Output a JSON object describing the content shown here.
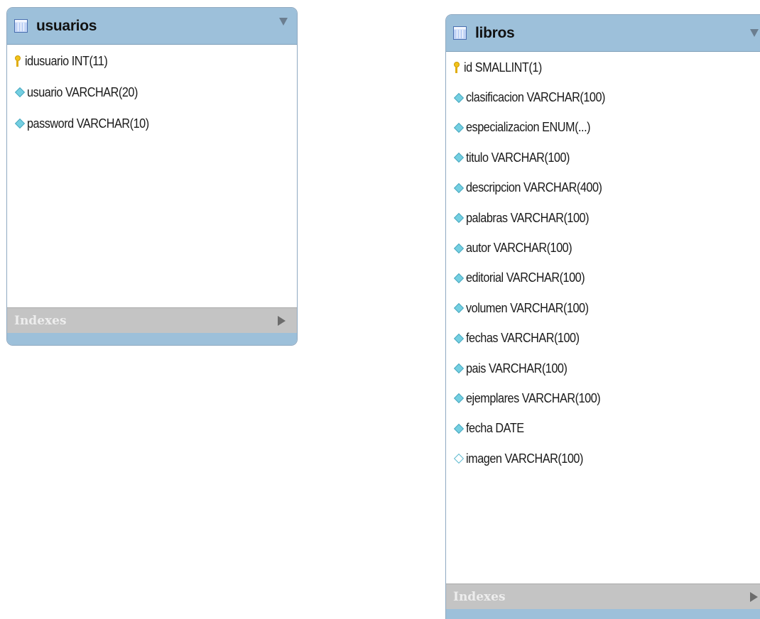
{
  "entities": {
    "usuarios": {
      "title": "usuarios",
      "columns": [
        {
          "text": "idusuario INT(11)",
          "icon": "primary-key-icon"
        },
        {
          "text": "usuario VARCHAR(20)",
          "icon": "column-diamond-icon"
        },
        {
          "text": "password VARCHAR(10)",
          "icon": "column-diamond-icon"
        }
      ],
      "indexes_label": "Indexes"
    },
    "libros": {
      "title": "libros",
      "columns": [
        {
          "text": "id SMALLINT(1)",
          "icon": "primary-key-icon"
        },
        {
          "text": "clasificacion VARCHAR(100)",
          "icon": "column-diamond-icon"
        },
        {
          "text": "especializacion ENUM(...)",
          "icon": "column-diamond-icon"
        },
        {
          "text": "titulo VARCHAR(100)",
          "icon": "column-diamond-icon"
        },
        {
          "text": "descripcion VARCHAR(400)",
          "icon": "column-diamond-icon"
        },
        {
          "text": "palabras VARCHAR(100)",
          "icon": "column-diamond-icon"
        },
        {
          "text": "autor VARCHAR(100)",
          "icon": "column-diamond-icon"
        },
        {
          "text": "editorial VARCHAR(100)",
          "icon": "column-diamond-icon"
        },
        {
          "text": "volumen VARCHAR(100)",
          "icon": "column-diamond-icon"
        },
        {
          "text": "fechas VARCHAR(100)",
          "icon": "column-diamond-icon"
        },
        {
          "text": "pais VARCHAR(100)",
          "icon": "column-diamond-icon"
        },
        {
          "text": "ejemplares VARCHAR(100)",
          "icon": "column-diamond-icon"
        },
        {
          "text": "fecha DATE",
          "icon": "column-diamond-icon"
        },
        {
          "text": "imagen VARCHAR(100)",
          "icon": "nullable-column-diamond-icon"
        }
      ],
      "indexes_label": "Indexes"
    }
  },
  "colors": {
    "header": "#9dc0da",
    "indexes_bar": "#c4c4c4",
    "key": "#f2c21a",
    "column_diamond": "#74cfe1"
  }
}
